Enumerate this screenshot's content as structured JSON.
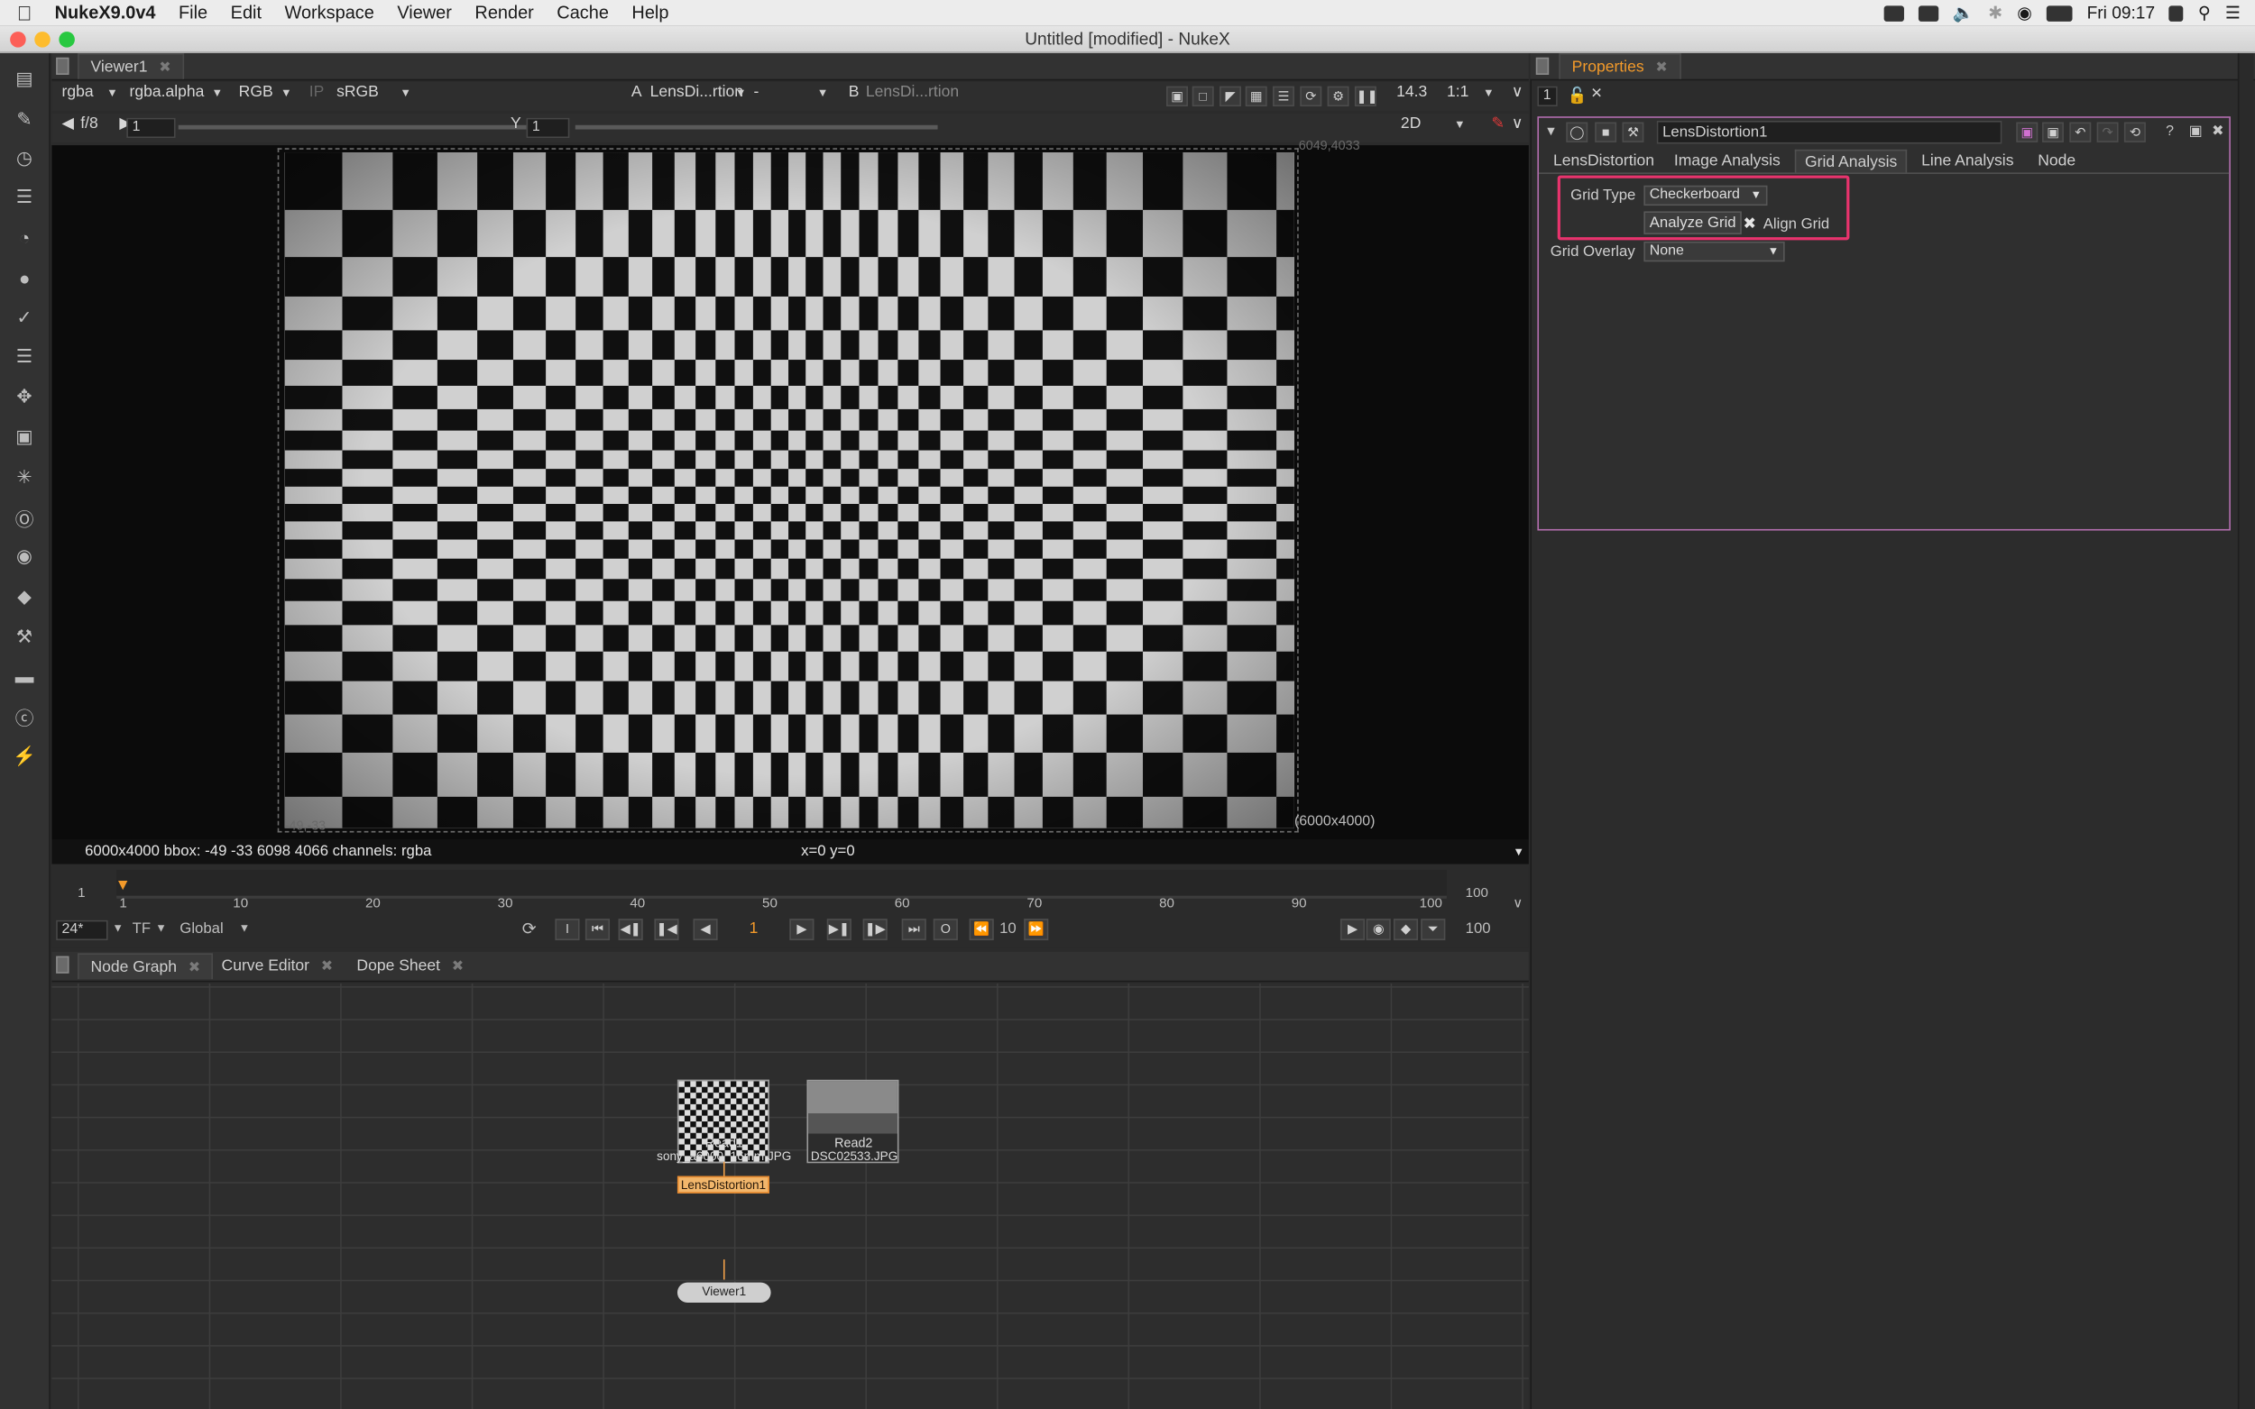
{
  "menubar": {
    "app": "NukeX9.0v4",
    "items": [
      "File",
      "Edit",
      "Workspace",
      "Viewer",
      "Render",
      "Cache",
      "Help"
    ],
    "clock": "Fri 09:17"
  },
  "window": {
    "title": "Untitled [modified] - NukeX"
  },
  "viewer": {
    "tab": "Viewer1",
    "channels": "rgba",
    "alpha": "rgba.alpha",
    "display": "RGB",
    "ip": "IP",
    "lut": "sRGB",
    "input_a_label": "A",
    "input_a": "LensDi...rtion",
    "input_mode": "-",
    "input_b_label": "B",
    "input_b": "LensDi...rtion",
    "zoom": "14.3",
    "ratio": "1:1",
    "fstop": "f/8",
    "gain": "1",
    "gamma_label": "Y",
    "gamma": "1",
    "view_mode": "2D",
    "corner_top": "6049,4033",
    "corner_bottom": "-49,-33",
    "format_label": "(6000x4000)",
    "info": "6000x4000  bbox: -49 -33 6098 4066 channels: rgba",
    "coords": "x=0 y=0"
  },
  "timeline": {
    "start": "1",
    "end": "100",
    "ticks": [
      "1",
      "10",
      "20",
      "30",
      "40",
      "50",
      "60",
      "70",
      "80",
      "90",
      "100"
    ],
    "fps": "24*",
    "tf": "TF",
    "scope": "Global",
    "current_frame": "1",
    "step": "10",
    "end_frame": "100",
    "in_label": "I",
    "out_label": "O"
  },
  "bottom_tabs": [
    "Node Graph",
    "Curve Editor",
    "Dope Sheet"
  ],
  "nodes": {
    "read1": {
      "name": "Read1",
      "file": "sony_a6000_16mm.JPG"
    },
    "read2": {
      "name": "Read2",
      "file": "DSC02533.JPG"
    },
    "lens": {
      "name": "LensDistortion1"
    },
    "viewer": {
      "name": "Viewer1"
    }
  },
  "properties": {
    "tab": "Properties",
    "max_panels": "1",
    "node_name": "LensDistortion1",
    "tabs": [
      "LensDistortion",
      "Image Analysis",
      "Grid Analysis",
      "Line Analysis",
      "Node"
    ],
    "grid_type_label": "Grid Type",
    "grid_type_value": "Checkerboard",
    "analyze_button": "Analyze Grid",
    "align_grid_label": "Align Grid",
    "grid_overlay_label": "Grid Overlay",
    "grid_overlay_value": "None"
  },
  "colors": {
    "highlight": "#e8336d",
    "active_tab": "#f39a2a",
    "node_selected": "#f2b66b",
    "panel_border": "#b46fb0"
  }
}
